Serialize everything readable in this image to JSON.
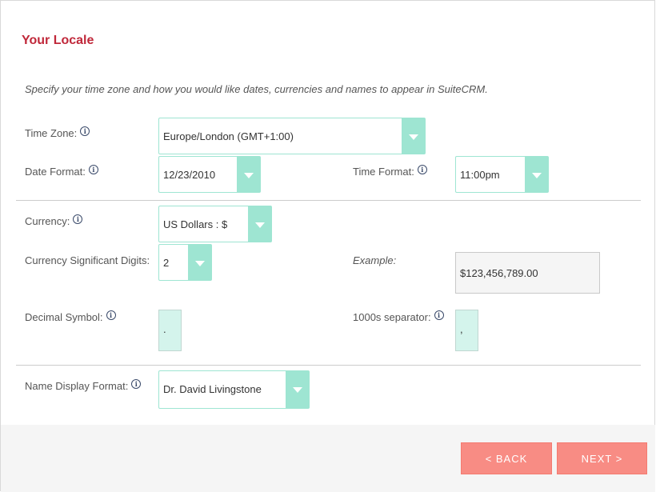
{
  "header": {
    "title": "Your Locale"
  },
  "intro": "Specify your time zone and how you would like dates, currencies and names to appear in SuiteCRM.",
  "fields": {
    "time_zone": {
      "label": "Time Zone:",
      "value": "Europe/London (GMT+1:00)"
    },
    "date_format": {
      "label": "Date Format:",
      "value": "12/23/2010"
    },
    "time_format": {
      "label": "Time Format:",
      "value": "11:00pm"
    },
    "currency": {
      "label": "Currency:",
      "value": "US Dollars : $"
    },
    "currency_digits": {
      "label": "Currency Significant Digits:",
      "value": "2"
    },
    "example": {
      "label": "Example:",
      "value": "$123,456,789.00"
    },
    "decimal_symbol": {
      "label": "Decimal Symbol:",
      "value": "."
    },
    "thousands_separator": {
      "label": "1000s separator:",
      "value": ","
    },
    "name_format": {
      "label": "Name Display Format:",
      "value": "Dr. David Livingstone"
    }
  },
  "icons": {
    "info": "info-icon",
    "dropdown": "chevron-down-icon"
  },
  "footer": {
    "back_label": "< BACK",
    "next_label": "NEXT >"
  },
  "colors": {
    "title": "#c0283a",
    "select_accent": "#9ee5d2",
    "button": "#f88c84"
  }
}
